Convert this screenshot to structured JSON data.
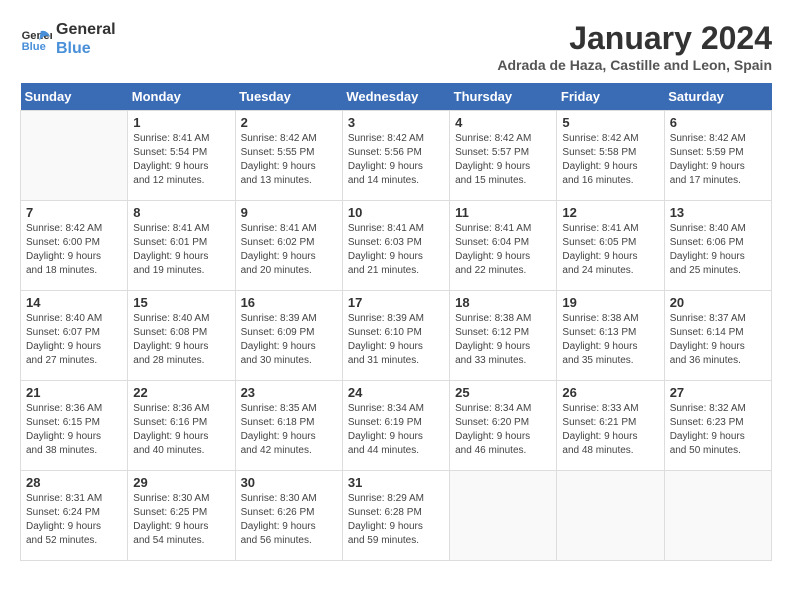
{
  "header": {
    "logo_line1": "General",
    "logo_line2": "Blue",
    "month_title": "January 2024",
    "subtitle": "Adrada de Haza, Castille and Leon, Spain"
  },
  "days_of_week": [
    "Sunday",
    "Monday",
    "Tuesday",
    "Wednesday",
    "Thursday",
    "Friday",
    "Saturday"
  ],
  "weeks": [
    [
      {
        "day": "",
        "info": ""
      },
      {
        "day": "1",
        "info": "Sunrise: 8:41 AM\nSunset: 5:54 PM\nDaylight: 9 hours\nand 12 minutes."
      },
      {
        "day": "2",
        "info": "Sunrise: 8:42 AM\nSunset: 5:55 PM\nDaylight: 9 hours\nand 13 minutes."
      },
      {
        "day": "3",
        "info": "Sunrise: 8:42 AM\nSunset: 5:56 PM\nDaylight: 9 hours\nand 14 minutes."
      },
      {
        "day": "4",
        "info": "Sunrise: 8:42 AM\nSunset: 5:57 PM\nDaylight: 9 hours\nand 15 minutes."
      },
      {
        "day": "5",
        "info": "Sunrise: 8:42 AM\nSunset: 5:58 PM\nDaylight: 9 hours\nand 16 minutes."
      },
      {
        "day": "6",
        "info": "Sunrise: 8:42 AM\nSunset: 5:59 PM\nDaylight: 9 hours\nand 17 minutes."
      }
    ],
    [
      {
        "day": "7",
        "info": "Sunrise: 8:42 AM\nSunset: 6:00 PM\nDaylight: 9 hours\nand 18 minutes."
      },
      {
        "day": "8",
        "info": "Sunrise: 8:41 AM\nSunset: 6:01 PM\nDaylight: 9 hours\nand 19 minutes."
      },
      {
        "day": "9",
        "info": "Sunrise: 8:41 AM\nSunset: 6:02 PM\nDaylight: 9 hours\nand 20 minutes."
      },
      {
        "day": "10",
        "info": "Sunrise: 8:41 AM\nSunset: 6:03 PM\nDaylight: 9 hours\nand 21 minutes."
      },
      {
        "day": "11",
        "info": "Sunrise: 8:41 AM\nSunset: 6:04 PM\nDaylight: 9 hours\nand 22 minutes."
      },
      {
        "day": "12",
        "info": "Sunrise: 8:41 AM\nSunset: 6:05 PM\nDaylight: 9 hours\nand 24 minutes."
      },
      {
        "day": "13",
        "info": "Sunrise: 8:40 AM\nSunset: 6:06 PM\nDaylight: 9 hours\nand 25 minutes."
      }
    ],
    [
      {
        "day": "14",
        "info": "Sunrise: 8:40 AM\nSunset: 6:07 PM\nDaylight: 9 hours\nand 27 minutes."
      },
      {
        "day": "15",
        "info": "Sunrise: 8:40 AM\nSunset: 6:08 PM\nDaylight: 9 hours\nand 28 minutes."
      },
      {
        "day": "16",
        "info": "Sunrise: 8:39 AM\nSunset: 6:09 PM\nDaylight: 9 hours\nand 30 minutes."
      },
      {
        "day": "17",
        "info": "Sunrise: 8:39 AM\nSunset: 6:10 PM\nDaylight: 9 hours\nand 31 minutes."
      },
      {
        "day": "18",
        "info": "Sunrise: 8:38 AM\nSunset: 6:12 PM\nDaylight: 9 hours\nand 33 minutes."
      },
      {
        "day": "19",
        "info": "Sunrise: 8:38 AM\nSunset: 6:13 PM\nDaylight: 9 hours\nand 35 minutes."
      },
      {
        "day": "20",
        "info": "Sunrise: 8:37 AM\nSunset: 6:14 PM\nDaylight: 9 hours\nand 36 minutes."
      }
    ],
    [
      {
        "day": "21",
        "info": "Sunrise: 8:36 AM\nSunset: 6:15 PM\nDaylight: 9 hours\nand 38 minutes."
      },
      {
        "day": "22",
        "info": "Sunrise: 8:36 AM\nSunset: 6:16 PM\nDaylight: 9 hours\nand 40 minutes."
      },
      {
        "day": "23",
        "info": "Sunrise: 8:35 AM\nSunset: 6:18 PM\nDaylight: 9 hours\nand 42 minutes."
      },
      {
        "day": "24",
        "info": "Sunrise: 8:34 AM\nSunset: 6:19 PM\nDaylight: 9 hours\nand 44 minutes."
      },
      {
        "day": "25",
        "info": "Sunrise: 8:34 AM\nSunset: 6:20 PM\nDaylight: 9 hours\nand 46 minutes."
      },
      {
        "day": "26",
        "info": "Sunrise: 8:33 AM\nSunset: 6:21 PM\nDaylight: 9 hours\nand 48 minutes."
      },
      {
        "day": "27",
        "info": "Sunrise: 8:32 AM\nSunset: 6:23 PM\nDaylight: 9 hours\nand 50 minutes."
      }
    ],
    [
      {
        "day": "28",
        "info": "Sunrise: 8:31 AM\nSunset: 6:24 PM\nDaylight: 9 hours\nand 52 minutes."
      },
      {
        "day": "29",
        "info": "Sunrise: 8:30 AM\nSunset: 6:25 PM\nDaylight: 9 hours\nand 54 minutes."
      },
      {
        "day": "30",
        "info": "Sunrise: 8:30 AM\nSunset: 6:26 PM\nDaylight: 9 hours\nand 56 minutes."
      },
      {
        "day": "31",
        "info": "Sunrise: 8:29 AM\nSunset: 6:28 PM\nDaylight: 9 hours\nand 59 minutes."
      },
      {
        "day": "",
        "info": ""
      },
      {
        "day": "",
        "info": ""
      },
      {
        "day": "",
        "info": ""
      }
    ]
  ]
}
